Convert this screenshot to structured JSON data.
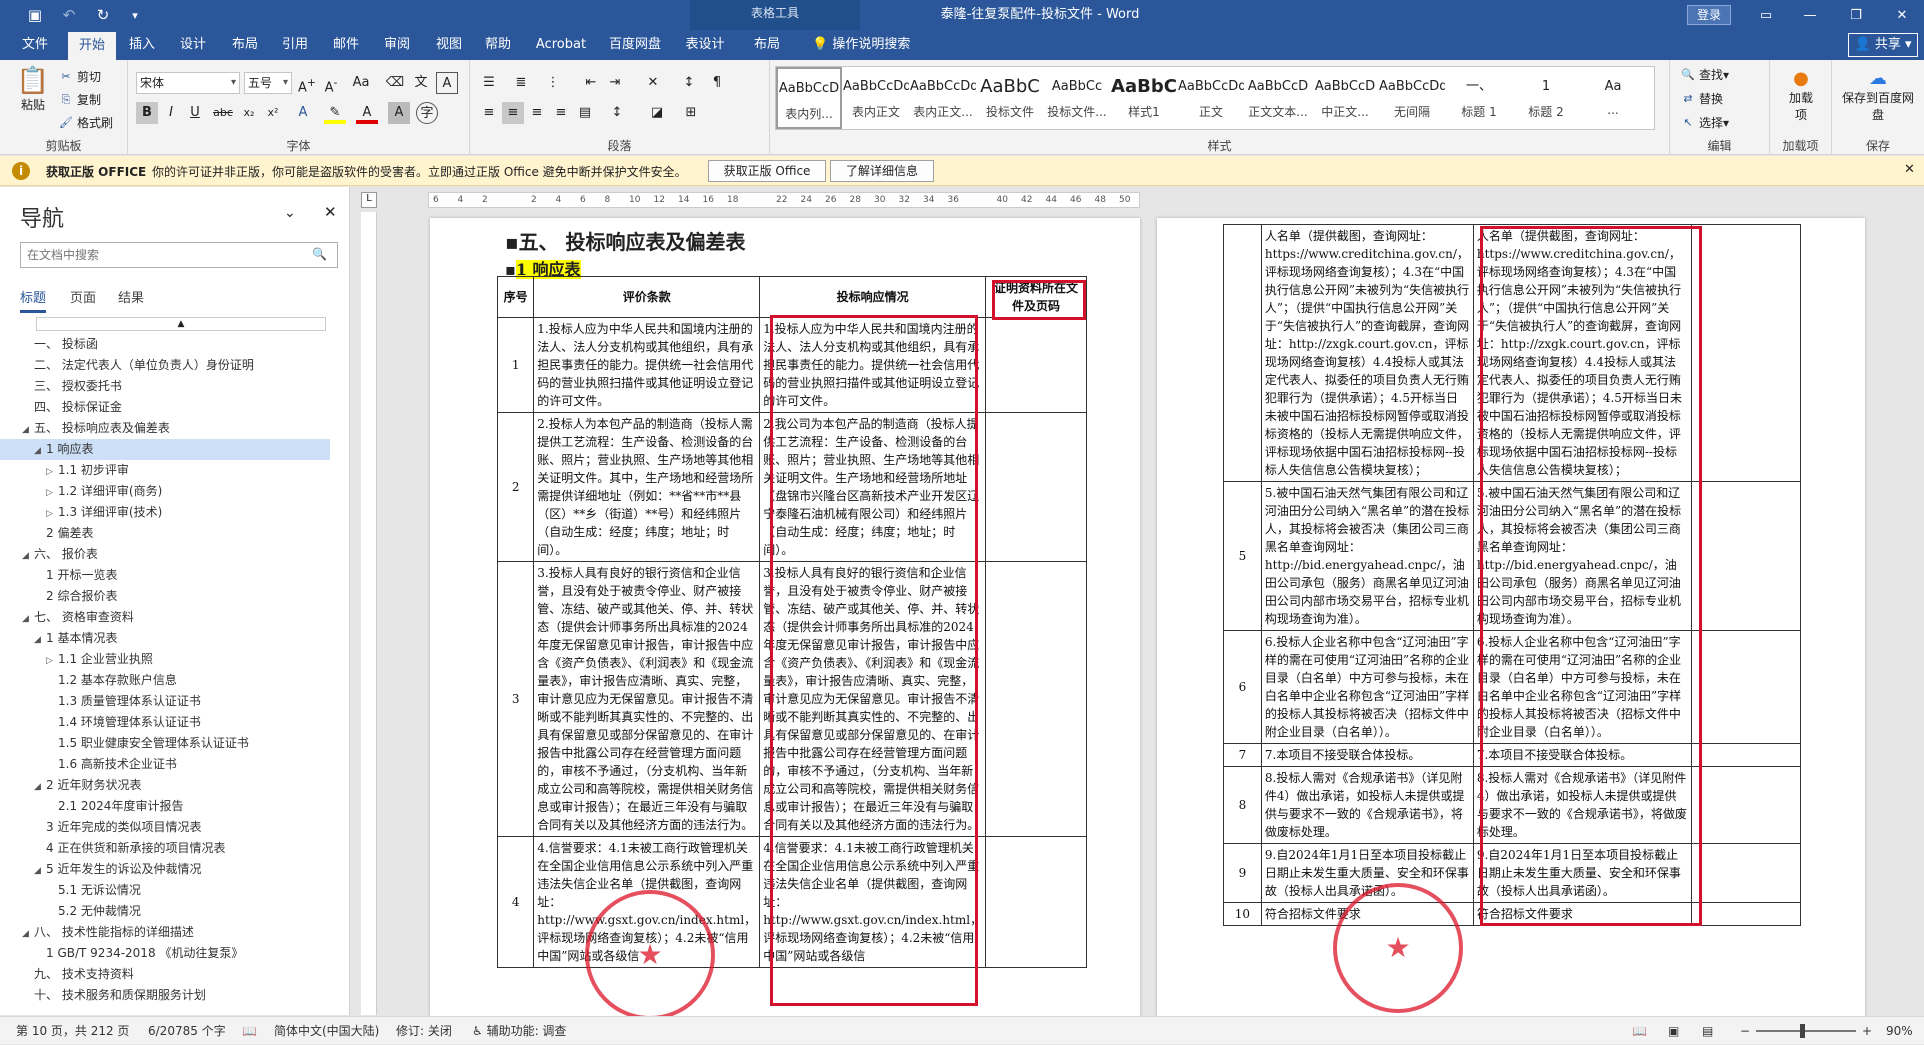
{
  "titlebar": {
    "context_tools": "表格工具",
    "doc_title": "泰隆-往复泵配件-投标文件  -  Word",
    "login": "登录",
    "share": "共享"
  },
  "tabs": [
    "文件",
    "开始",
    "插入",
    "设计",
    "布局",
    "引用",
    "邮件",
    "审阅",
    "视图",
    "帮助",
    "Acrobat",
    "百度网盘",
    "表设计",
    "布局",
    "操作说明搜索"
  ],
  "ribbon": {
    "clipboard": {
      "paste": "粘贴",
      "cut": "剪切",
      "copy": "复制",
      "format_painter": "格式刷",
      "label": "剪贴板"
    },
    "font": {
      "name": "宋体",
      "size": "五号",
      "label": "字体"
    },
    "paragraph": {
      "label": "段落"
    },
    "styles": {
      "label": "样式",
      "items": [
        {
          "sample": "AaBbCcD",
          "name": "表内列..."
        },
        {
          "sample": "AaBbCcDdI",
          "name": "表内正文"
        },
        {
          "sample": "AaBbCcDd",
          "name": "表内正文..."
        },
        {
          "sample": "AaBbC",
          "name": "投标文件"
        },
        {
          "sample": "AaBbCc",
          "name": "投标文件..."
        },
        {
          "sample": "AaBbC",
          "name": "样式1"
        },
        {
          "sample": "AaBbCcDdI",
          "name": "正文"
        },
        {
          "sample": "AaBbCcD",
          "name": "正文文本..."
        },
        {
          "sample": "AaBbCcD",
          "name": "中正文..."
        },
        {
          "sample": "AaBbCcDdI",
          "name": "无间隔"
        },
        {
          "sample": "一、",
          "name": "标题 1"
        },
        {
          "sample": "1",
          "name": "标题 2"
        },
        {
          "sample": "Aa",
          "name": "..."
        }
      ]
    },
    "editing": {
      "find": "查找",
      "replace": "替换",
      "select": "选择",
      "label": "编辑"
    },
    "addins": {
      "label": "加载项",
      "btn": "加载项"
    },
    "save": {
      "label": "保存",
      "btn": "保存到百度网盘"
    }
  },
  "msgbar": {
    "title": "获取正版 OFFICE",
    "text": "你的许可证并非正版，你可能是盗版软件的受害者。立即通过正版 Office 避免中断并保护文件安全。",
    "btn1": "获取正版 Office",
    "btn2": "了解详细信息"
  },
  "nav": {
    "title": "导航",
    "search_placeholder": "在文档中搜索",
    "tabs": [
      "标题",
      "页面",
      "结果"
    ],
    "items": [
      {
        "t": "一、 投标函",
        "lvl": 1,
        "tri": ""
      },
      {
        "t": "二、 法定代表人（单位负责人）身份证明",
        "lvl": 1,
        "tri": ""
      },
      {
        "t": "三、 授权委托书",
        "lvl": 1,
        "tri": ""
      },
      {
        "t": "四、 投标保证金",
        "lvl": 1,
        "tri": ""
      },
      {
        "t": "五、 投标响应表及偏差表",
        "lvl": 1,
        "tri": "◢"
      },
      {
        "t": "1 响应表",
        "lvl": 2,
        "tri": "◢",
        "sel": true
      },
      {
        "t": "1.1 初步评审",
        "lvl": 3,
        "tri": "▷"
      },
      {
        "t": "1.2 详细评审(商务)",
        "lvl": 3,
        "tri": "▷"
      },
      {
        "t": "1.3 详细评审(技术)",
        "lvl": 3,
        "tri": "▷"
      },
      {
        "t": "2 偏差表",
        "lvl": 2,
        "tri": ""
      },
      {
        "t": "六、 报价表",
        "lvl": 1,
        "tri": "◢"
      },
      {
        "t": "1 开标一览表",
        "lvl": 2,
        "tri": ""
      },
      {
        "t": "2 综合报价表",
        "lvl": 2,
        "tri": ""
      },
      {
        "t": "七、 资格审查资料",
        "lvl": 1,
        "tri": "◢"
      },
      {
        "t": "1 基本情况表",
        "lvl": 2,
        "tri": "◢"
      },
      {
        "t": "1.1 企业营业执照",
        "lvl": 3,
        "tri": "▷"
      },
      {
        "t": "1.2 基本存款账户信息",
        "lvl": 3,
        "tri": ""
      },
      {
        "t": "1.3 质量管理体系认证证书",
        "lvl": 3,
        "tri": ""
      },
      {
        "t": "1.4 环境管理体系认证证书",
        "lvl": 3,
        "tri": ""
      },
      {
        "t": "1.5 职业健康安全管理体系认证证书",
        "lvl": 3,
        "tri": ""
      },
      {
        "t": "1.6 高新技术企业证书",
        "lvl": 3,
        "tri": ""
      },
      {
        "t": "2 近年财务状况表",
        "lvl": 2,
        "tri": "◢"
      },
      {
        "t": "2.1 2024年度审计报告",
        "lvl": 3,
        "tri": ""
      },
      {
        "t": "3 近年完成的类似项目情况表",
        "lvl": 2,
        "tri": ""
      },
      {
        "t": "4 正在供货和新承接的项目情况表",
        "lvl": 2,
        "tri": ""
      },
      {
        "t": "5 近年发生的诉讼及仲裁情况",
        "lvl": 2,
        "tri": "◢"
      },
      {
        "t": "5.1 无诉讼情况",
        "lvl": 3,
        "tri": ""
      },
      {
        "t": "5.2 无仲裁情况",
        "lvl": 3,
        "tri": ""
      },
      {
        "t": "八、 技术性能指标的详细描述",
        "lvl": 1,
        "tri": "◢"
      },
      {
        "t": "1 GB/T 9234-2018 《机动往复泵》",
        "lvl": 2,
        "tri": ""
      },
      {
        "t": "九、 技术支持资料",
        "lvl": 1,
        "tri": ""
      },
      {
        "t": "十、 技术服务和质保期服务计划",
        "lvl": 1,
        "tri": ""
      }
    ]
  },
  "page1": {
    "heading": "五、 投标响应表及偏差表",
    "subheading": "1 响应表",
    "headers": [
      "序号",
      "评价条款",
      "投标响应情况",
      "证明资料所在文件及页码"
    ],
    "rows": [
      {
        "no": "1",
        "clause": "1.投标人应为中华人民共和国境内注册的法人、法人分支机构或其他组织，具有承担民事责任的能力。提供统一社会信用代码的营业执照扫描件或其他证明设立登记的许可文件。",
        "resp": "1.投标人应为中华人民共和国境内注册的法人、法人分支机构或其他组织，具有承担民事责任的能力。提供统一社会信用代码的营业执照扫描件或其他证明设立登记的许可文件。"
      },
      {
        "no": "2",
        "clause": "2.投标人为本包产品的制造商（投标人需提供工艺流程：生产设备、检测设备的台账、照片；营业执照、生产场地等其他相关证明文件。其中，生产场地和经营场所需提供详细地址（例如：**省**市**县（区）**乡（街道）**号）和经纬照片（自动生成：经度；纬度；地址；时间）。",
        "resp": "2.我公司为本包产品的制造商（投标人提供工艺流程：生产设备、检测设备的台账、照片；营业执照、生产场地等其他相关证明文件。生产场地和经营场所地址（盘锦市兴隆台区高新技术产业开发区辽宁泰隆石油机械有限公司）和经纬照片（自动生成：经度；纬度；地址；时间）。"
      },
      {
        "no": "3",
        "clause": "3.投标人具有良好的银行资信和企业信誉，且没有处于被责令停业、财产被接管、冻结、破产或其他关、停、并、转状态（提供会计师事务所出具标准的2024年度无保留意见审计报告，审计报告中应含《资产负债表》、《利润表》和《现金流量表》，审计报告应清晰、真实、完整，审计意见应为无保留意见。审计报告不清晰或不能判断其真实性的、不完整的、出具有保留意见或部分保留意见的、在审计报告中批露公司存在经营管理方面问题的，审核不予通过，（分支机构、当年新成立公司和高等院校，需提供相关财务信息或审计报告）；在最近三年没有与骗取合同有关以及其他经济方面的违法行为。",
        "resp": "3.投标人具有良好的银行资信和企业信誉，且没有处于被责令停业、财产被接管、冻结、破产或其他关、停、并、转状态（提供会计师事务所出具标准的2024年度无保留意见审计报告，审计报告中应含《资产负债表》、《利润表》和《现金流量表》，审计报告应清晰、真实、完整，审计意见应为无保留意见。审计报告不清晰或不能判断其真实性的、不完整的、出具有保留意见或部分保留意见的、在审计报告中批露公司存在经营管理方面问题的，审核不予通过，（分支机构、当年新成立公司和高等院校，需提供相关财务信息或审计报告）；在最近三年没有与骗取合同有关以及其他经济方面的违法行为。"
      },
      {
        "no": "4",
        "clause": "4.信誉要求：4.1未被工商行政管理机关在全国企业信用信息公示系统中列入严重违法失信企业名单（提供截图，查询网址：http://www.gsxt.gov.cn/index.html，评标现场网络查询复核）；4.2未被“信用中国”网站或各级信",
        "resp": "4.信誉要求：4.1未被工商行政管理机关在全国企业信用信息公示系统中列入严重违法失信企业名单（提供截图，查询网址：http://www.gsxt.gov.cn/index.html，评标现场网络查询复核）；4.2未被“信用中国”网站或各级信"
      }
    ]
  },
  "page2": {
    "rows": [
      {
        "no": "",
        "clause": "人名单（提供截图，查询网址：https://www.creditchina.gov.cn/，评标现场网络查询复核）；4.3在“中国执行信息公开网”未被列为“失信被执行人”；（提供“中国执行信息公开网”关于“失信被执行人”的查询截屏，查询网址：http://zxgk.court.gov.cn，评标现场网络查询复核）4.4投标人或其法定代表人、拟委任的项目负责人无行贿犯罪行为（提供承诺）；4.5开标当日未被中国石油招标投标网暂停或取消投标资格的（投标人无需提供响应文件，评标现场依据中国石油招标投标网--投标人失信信息公告模块复核）；",
        "resp": "人名单（提供截图，查询网址：https://www.creditchina.gov.cn/，评标现场网络查询复核）；4.3在“中国执行信息公开网”未被列为“失信被执行人”；（提供“中国执行信息公开网”关于“失信被执行人”的查询截屏，查询网址：http://zxgk.court.gov.cn，评标现场网络查询复核）4.4投标人或其法定代表人、拟委任的项目负责人无行贿犯罪行为（提供承诺）；4.5开标当日未被中国石油招标投标网暂停或取消投标资格的（投标人无需提供响应文件，评标现场依据中国石油招标投标网--投标人失信信息公告模块复核）；"
      },
      {
        "no": "5",
        "clause": "5.被中国石油天然气集团有限公司和辽河油田分公司纳入“黑名单”的潜在投标人，其投标将会被否决（集团公司三商黑名单查询网址：http://bid.energyahead.cnpc/，油田公司承包（服务）商黑名单见辽河油田公司内部市场交易平台，招标专业机构现场查询为准）。",
        "resp": "5.被中国石油天然气集团有限公司和辽河油田分公司纳入“黑名单”的潜在投标人，其投标将会被否决（集团公司三商黑名单查询网址：http://bid.energyahead.cnpc/，油田公司承包（服务）商黑名单见辽河油田公司内部市场交易平台，招标专业机构现场查询为准）。"
      },
      {
        "no": "6",
        "clause": "6.投标人企业名称中包含“辽河油田”字样的需在可使用“辽河油田”名称的企业目录（白名单）中方可参与投标，未在白名单中企业名称包含“辽河油田”字样的投标人其投标将被否决（招标文件中附企业目录（白名单））。",
        "resp": "6.投标人企业名称中包含“辽河油田”字样的需在可使用“辽河油田”名称的企业目录（白名单）中方可参与投标，未在白名单中企业名称包含“辽河油田”字样的投标人其投标将被否决（招标文件中附企业目录（白名单））。"
      },
      {
        "no": "7",
        "clause": "7.本项目不接受联合体投标。",
        "resp": "7.本项目不接受联合体投标。"
      },
      {
        "no": "8",
        "clause": "8.投标人需对《合规承诺书》（详见附件4）做出承诺，如投标人未提供或提供与要求不一致的《合规承诺书》，将做废标处理。",
        "resp": "8.投标人需对《合规承诺书》（详见附件4）做出承诺，如投标人未提供或提供与要求不一致的《合规承诺书》，将做废标处理。"
      },
      {
        "no": "9",
        "clause": "9.自2024年1月1日至本项目投标截止日期止未发生重大质量、安全和环保事故（投标人出具承诺函）。",
        "resp": "9.自2024年1月1日至本项目投标截止日期止未发生重大质量、安全和环保事故（投标人出具承诺函）。"
      },
      {
        "no": "10",
        "clause": "符合招标文件要求",
        "resp": "符合招标文件要求"
      }
    ]
  },
  "status": {
    "page": "第 10 页，共 212 页",
    "words": "6/20785 个字",
    "lang": "简体中文(中国大陆)",
    "track": "修订: 关闭",
    "access": "辅助功能: 调查",
    "zoom": "90%"
  }
}
